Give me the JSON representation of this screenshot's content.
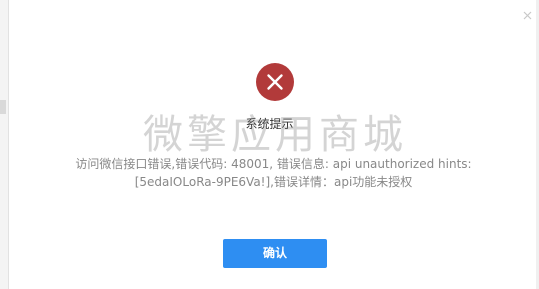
{
  "dialog": {
    "title": "系统提示",
    "message": "访问微信接口错误,错误代码: 48001, 错误信息: api unauthorized hints: [5edaIOLoRa-9PE6Va!],错误详情：api功能未授权",
    "confirm_label": "确认",
    "close_icon": "close-icon",
    "status_icon": "error-icon"
  },
  "watermark": {
    "text": "微擎应用商城"
  },
  "colors": {
    "error": "#b23a3a",
    "button": "#2e8ef2",
    "message_text": "#888888",
    "title_text": "#333333"
  }
}
